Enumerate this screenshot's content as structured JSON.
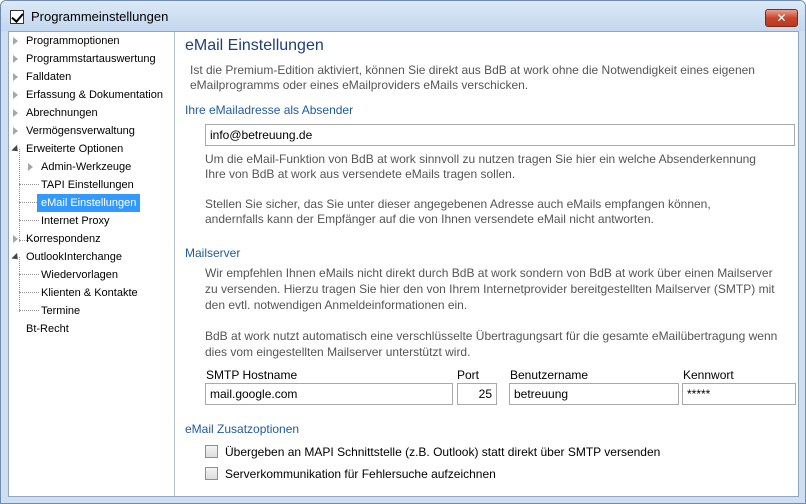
{
  "window": {
    "title": "Programmeinstellungen",
    "close_symbol": "✕"
  },
  "sidebar": {
    "items": [
      {
        "label": "Programmoptionen"
      },
      {
        "label": "Programmstartauswertung"
      },
      {
        "label": "Falldaten"
      },
      {
        "label": "Erfassung & Dokumentation"
      },
      {
        "label": "Abrechnungen"
      },
      {
        "label": "Vermögensverwaltung"
      },
      {
        "label": "Erweiterte Optionen"
      },
      {
        "label": "Admin-Werkzeuge"
      },
      {
        "label": "TAPI Einstellungen"
      },
      {
        "label": "eMail Einstellungen"
      },
      {
        "label": "Internet Proxy"
      },
      {
        "label": "Korrespondenz"
      },
      {
        "label": "OutlookInterchange"
      },
      {
        "label": "Wiedervorlagen"
      },
      {
        "label": "Klienten & Kontakte"
      },
      {
        "label": "Termine"
      },
      {
        "label": "Bt-Recht"
      }
    ],
    "selected": "eMail Einstellungen"
  },
  "main": {
    "title": "eMail Einstellungen",
    "intro_1": "Ist die Premium-Edition aktiviert, können Sie direkt aus BdB at work ohne die Notwendigkeit eines eigenen",
    "intro_2": "eMailprogramms oder eines eMailproviders eMails verschicken.",
    "sender": {
      "heading": "Ihre eMailadresse als Absender",
      "value": "info@betreuung.de",
      "desc_1": "Um die eMail-Funktion von BdB at work sinnvoll zu nutzen tragen Sie hier ein welche Absenderkennung",
      "desc_2": "Ihre von BdB at work aus versendete eMails tragen sollen.",
      "desc_3": "Stellen Sie sicher, das Sie unter dieser angegebenen Adresse auch eMails empfangen können,",
      "desc_4": "andernfalls kann der Empfänger auf die von Ihnen versendete eMail nicht antworten."
    },
    "mailserver": {
      "heading": "Mailserver",
      "desc_1": "Wir empfehlen Ihnen eMails nicht direkt durch BdB at work sondern von BdB at work über einen Mailserver",
      "desc_2": "zu versenden. Hierzu tragen Sie hier den von Ihrem Internetprovider bereitgestellten Mailserver (SMTP) mit",
      "desc_3": "den evtl. notwendigen Anmeldeinformationen ein.",
      "desc_4": "BdB at work nutzt automatisch eine verschlüsselte Übertragungsart für die gesamte eMailübertragung wenn",
      "desc_5": "dies vom eingestellten Mailserver unterstützt wird.",
      "host_label": "SMTP Hostname",
      "host_value": "mail.google.com",
      "port_label": "Port",
      "port_value": "25",
      "user_label": "Benutzername",
      "user_value": "betreuung",
      "pass_label": "Kennwort",
      "pass_value": "*****"
    },
    "extras": {
      "heading": "eMail Zusatzoptionen",
      "opt1": "Übergeben an MAPI Schnittstelle (z.B. Outlook) statt direkt über SMTP versenden",
      "opt2": "Serverkommunikation für Fehlersuche aufzeichnen"
    }
  }
}
